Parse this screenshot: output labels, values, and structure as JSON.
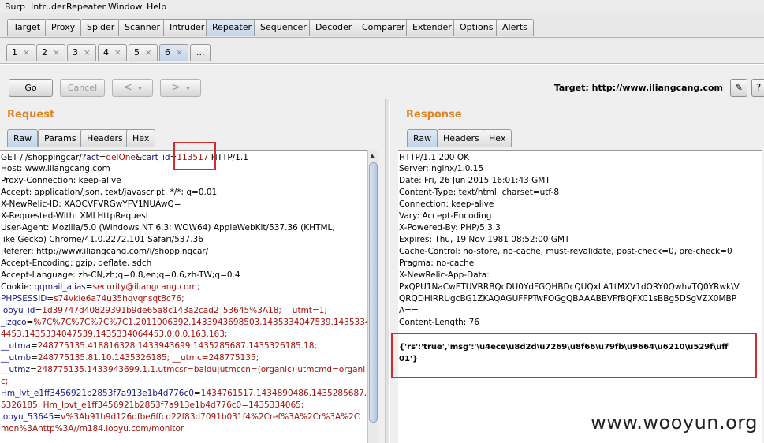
{
  "menu": [
    "Burp",
    "Intruder",
    "Repeater",
    "Window",
    "Help"
  ],
  "main_tabs": [
    "Target",
    "Proxy",
    "Spider",
    "Scanner",
    "Intruder",
    "Repeater",
    "Sequencer",
    "Decoder",
    "Comparer",
    "Extender",
    "Options",
    "Alerts"
  ],
  "active_main_tab": "Repeater",
  "sub_tabs": [
    "1",
    "2",
    "3",
    "4",
    "5",
    "6",
    "..."
  ],
  "sub_tab_close": "×",
  "active_sub_tab": "6",
  "toolbar": {
    "go": "Go",
    "cancel": "Cancel",
    "back": "<",
    "forward": ">",
    "dropdown": "▾",
    "target_label": "Target: http://www.iliangcang.com",
    "edit_icon": "✎",
    "help_icon": "?"
  },
  "request": {
    "title": "Request",
    "tabs": [
      "Raw",
      "Params",
      "Headers",
      "Hex"
    ],
    "active_tab": "Raw",
    "line1": {
      "pre": "GET /i/shoppingcar/?",
      "p1": "act",
      "eq1": "=",
      "v1": "delOne",
      "amp": "&",
      "p2": "cart_id",
      "eq2": "=",
      "v2": "113517",
      "post": " HTTP/1.1"
    },
    "lines": [
      "Host: www.iliangcang.com",
      "Proxy-Connection: keep-alive",
      "Accept: application/json, text/javascript, */*; q=0.01",
      "X-NewRelic-ID: XAQCVFVRGwYFV1NUAwQ=",
      "X-Requested-With: XMLHttpRequest",
      "User-Agent: Mozilla/5.0 (Windows NT 6.3; WOW64) AppleWebKit/537.36 (KHTML,",
      "like Gecko) Chrome/41.0.2272.101 Safari/537.36",
      "Referer: http://www.iliangcang.com/i/shoppingcar/",
      "Accept-Encoding: gzip, deflate, sdch",
      "Accept-Language: zh-CN,zh;q=0.8,en;q=0.6,zh-TW;q=0.4"
    ],
    "cookies": [
      {
        "k": "Cookie: ",
        "name": "qqmail_alias",
        "v": "security@iliangcang.com;"
      },
      {
        "k": "",
        "name": "PHPSESSID",
        "v": "s74vkle6a74u35hqvqnsqt8c76;"
      },
      {
        "k": "",
        "name": "looyu_id",
        "v": "1d39747d40829391b9de65a8c143a2cad2_53645%3A18; __utmt=1;"
      },
      {
        "k": "",
        "name": "_jzqco",
        "v": "%7C%7C%7C%7C%7C1.2011006392.1433943698503.1435334047539.143533404"
      },
      {
        "k": "",
        "name": "",
        "v": "4453.1435334047539.1435334064453.0.0.0.163.163;"
      },
      {
        "k": "",
        "name": "__utma",
        "v": "248775135.418816328.1433943699.1435285687.1435326185.18;"
      },
      {
        "k": "",
        "name": "__utmb",
        "v": "248775135.81.10.1435326185; __utmc=248775135;"
      },
      {
        "k": "",
        "name": "__utmz",
        "v": "248775135.1433943699.1.1.utmcsr=baidu|utmccn=(organic)|utmcmd=organi"
      },
      {
        "k": "",
        "name": "",
        "v": "c;"
      },
      {
        "k": "",
        "name": "Hm_lvt_e1ff3456921b2853f7a913e1b4d776c0",
        "v": "1434761517,1434890486,1435285687,143"
      },
      {
        "k": "",
        "name": "",
        "v": "5326185; Hm_lpvt_e1ff3456921b2853f7a913e1b4d776c0=1435334065;"
      },
      {
        "k": "",
        "name": "looyu_53645",
        "v": "v%3Ab91b9d126dfbe6ffcd22f83d7091b031f4%2Cref%3A%2Cr%3A%2C"
      },
      {
        "k": "",
        "name": "",
        "v": "mon%3Ahttp%3A//m184.looyu.com/monitor"
      }
    ]
  },
  "response": {
    "title": "Response",
    "tabs": [
      "Raw",
      "Headers",
      "Hex"
    ],
    "active_tab": "Raw",
    "lines": [
      "HTTP/1.1 200 OK",
      "Server: nginx/1.0.15",
      "Date: Fri, 26 Jun 2015 16:01:43 GMT",
      "Content-Type: text/html; charset=utf-8",
      "Connection: keep-alive",
      "Vary: Accept-Encoding",
      "X-Powered-By: PHP/5.3.3",
      "Expires: Thu, 19 Nov 1981 08:52:00 GMT",
      "Cache-Control: no-store, no-cache, must-revalidate, post-check=0, pre-check=0",
      "Pragma: no-cache",
      "X-NewRelic-App-Data:",
      "PxQPU1NaCwETUVRRBQcDU0YdFGQHBDcQUQxLA1tMXV1dORY0QwhvTQ0YRwk\\V",
      "QRQDHlRRUgcBG1ZKAQAGUFFPTwFOGgQBAAABBVFfBQFXC1sBBg5DSgVZX0MBP",
      "A==",
      "Content-Length: 76"
    ],
    "body_line1": "{'rs':'true','msg':'\\u4ece\\u8d2d\\u7269\\u8f66\\u79fb\\u9664\\u6210\\u529f\\uff",
    "body_line2": "01'}"
  },
  "watermark": "www.wooyun.org",
  "colors": {
    "section_title": "#e0862a",
    "highlight_box": "#d12b2b",
    "param_name": "#1a1a8c",
    "param_value": "#a0130f"
  }
}
